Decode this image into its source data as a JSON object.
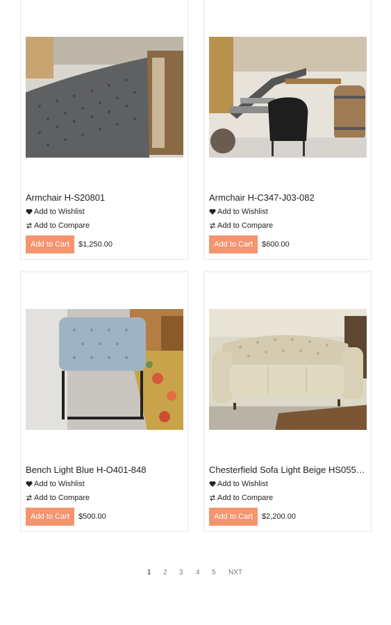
{
  "products": [
    {
      "title": "Armchair H-S20801",
      "wishlist_label": "Add to Wishlist",
      "compare_label": "Add to Compare",
      "cart_label": "Add to Cart",
      "price": "$1,250.00"
    },
    {
      "title": "Armchair H-C347-J03-082",
      "wishlist_label": "Add to Wishlist",
      "compare_label": "Add to Compare",
      "cart_label": "Add to Cart",
      "price": "$600.00"
    },
    {
      "title": "Bench Light Blue H-O401-848",
      "wishlist_label": "Add to Wishlist",
      "compare_label": "Add to Compare",
      "cart_label": "Add to Cart",
      "price": "$500.00"
    },
    {
      "title": "Chesterfield Sofa Light Beige HS0550...",
      "wishlist_label": "Add to Wishlist",
      "compare_label": "Add to Compare",
      "cart_label": "Add to Cart",
      "price": "$2,200.00"
    }
  ],
  "pagination": {
    "pages": [
      "1",
      "2",
      "3",
      "4",
      "5"
    ],
    "current": "1",
    "next_label": "NXT"
  },
  "colors": {
    "cart_button": "#f4956f",
    "card_border": "#e6e6e6"
  },
  "icons": {
    "wishlist": "heart-icon",
    "compare": "compare-icon"
  }
}
